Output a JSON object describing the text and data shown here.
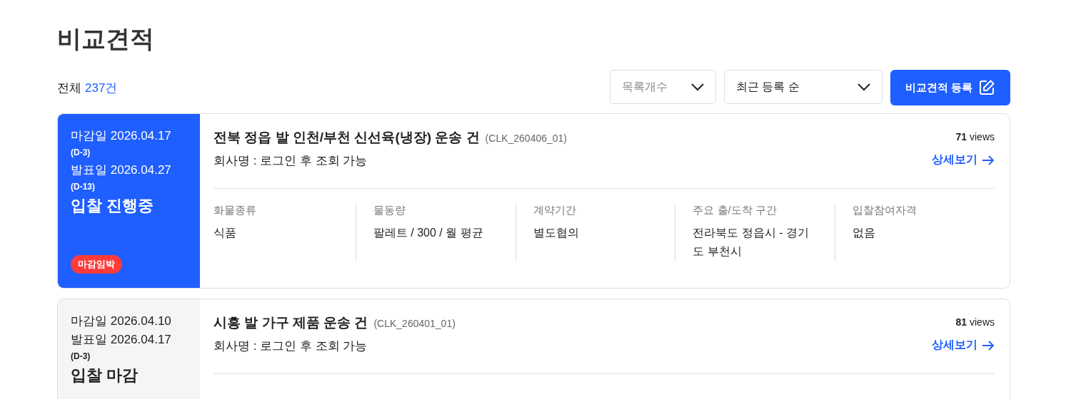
{
  "page_title": "비교견적",
  "total": {
    "label": "전체",
    "count": "237건"
  },
  "toolbar": {
    "page_size": {
      "placeholder": "목록개수"
    },
    "sort": {
      "value": "최근 등록 순"
    },
    "register_button": "비교견적 등록"
  },
  "cards": [
    {
      "kind": "open",
      "deadline": {
        "label": "마감일 2026.04.17",
        "dday": "(D-3)"
      },
      "announce": {
        "label": "발표일 2026.04.27",
        "dday": "(D-13)"
      },
      "status_text": "입찰 진행중",
      "badge": "마감임박",
      "title": "전북 정읍 발 인천/부천 신선육(냉장) 운송 건",
      "code": "(CLK_260406_01)",
      "company": "회사명 : 로그인 후 조회 가능",
      "views_count": "71",
      "views_label": "views",
      "detail_link": "상세보기",
      "details": [
        {
          "label": "화물종류",
          "value": "식품"
        },
        {
          "label": "물동량",
          "value": "팔레트 / 300 / 월 평균"
        },
        {
          "label": "계약기간",
          "value": "별도협의"
        },
        {
          "label": "주요 출/도착 구간",
          "value": "전라북도 정읍시 - 경기도 부천시"
        },
        {
          "label": "입찰참여자격",
          "value": "없음"
        }
      ]
    },
    {
      "kind": "closed",
      "deadline": {
        "label": "마감일 2026.04.10"
      },
      "announce": {
        "label": "발표일 2026.04.17",
        "dday": "(D-3)"
      },
      "status_text": "입찰 마감",
      "title": "시흥 발 가구 제품 운송 건",
      "code": "(CLK_260401_01)",
      "company": "회사명 : 로그인 후 조회 가능",
      "views_count": "81",
      "views_label": "views",
      "detail_link": "상세보기"
    }
  ]
}
